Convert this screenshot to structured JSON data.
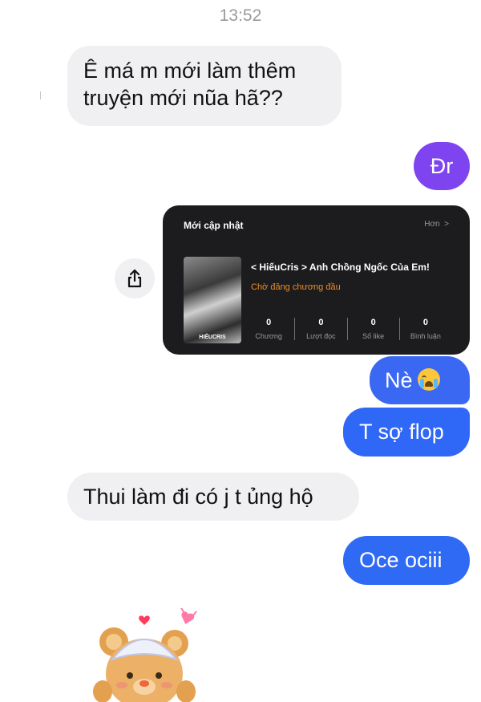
{
  "time": "13:52",
  "messages": [
    {
      "side": "in",
      "text_line1": "Ê má m mới làm thêm",
      "text_line2": "truyện mới nũa hã??"
    },
    {
      "side": "out",
      "text": "Đr"
    },
    {
      "side": "out",
      "text": "Nè"
    },
    {
      "side": "out",
      "text": "T sợ flop"
    },
    {
      "side": "in",
      "text": "Thui làm đi có j t ủng hộ"
    },
    {
      "side": "out",
      "text": "Oce ociii"
    }
  ],
  "emoji_icon": "loudly-crying-face-icon",
  "share_icon": "share-icon",
  "card": {
    "section_title": "Mới cập nhật",
    "more_label": "Hơn",
    "story_title": "< HiếuCris > Anh Chồng Ngốc Của Em!",
    "status": "Chờ đăng chương đầu",
    "cover_label": "HIẾUCRIS",
    "stats": [
      {
        "value": "0",
        "label": "Chương"
      },
      {
        "value": "0",
        "label": "Lượt đọc"
      },
      {
        "value": "0",
        "label": "Số like"
      },
      {
        "value": "0",
        "label": "Bình luận"
      }
    ]
  },
  "sticker": "teddy-bear-sticker",
  "colors": {
    "purple_bubble": "#7e44f0",
    "blue_bubble": "#2f67f6",
    "incoming_bubble": "#f0f0f2",
    "status_orange": "#f08a22"
  }
}
